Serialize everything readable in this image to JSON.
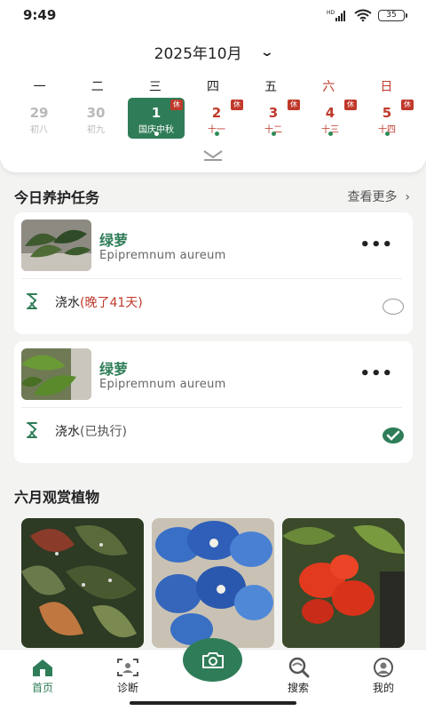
{
  "status": {
    "time": "9:49",
    "network": "HD",
    "battery": "35"
  },
  "calendar": {
    "month": "2025年10月",
    "weekdays": [
      "一",
      "二",
      "三",
      "四",
      "五",
      "六",
      "日"
    ],
    "days": [
      {
        "num": "29",
        "lunar": "初八"
      },
      {
        "num": "30",
        "lunar": "初九"
      },
      {
        "num": "1",
        "lunar": "国庆中秋",
        "badge": "休"
      },
      {
        "num": "2",
        "lunar": "十一",
        "badge": "休"
      },
      {
        "num": "3",
        "lunar": "十二",
        "badge": "休"
      },
      {
        "num": "4",
        "lunar": "十三",
        "badge": "休"
      },
      {
        "num": "5",
        "lunar": "十四",
        "badge": "休"
      }
    ]
  },
  "tasks": {
    "title": "今日养护任务",
    "more": "查看更多",
    "items": [
      {
        "name": "绿萝",
        "latin": "Epipremnum aureum",
        "task": "浇水",
        "status": "(晚了41天)",
        "checked": false
      },
      {
        "name": "绿萝",
        "latin": "Epipremnum aureum",
        "task": "浇水",
        "status": "(已执行)",
        "checked": true
      }
    ]
  },
  "featured": {
    "title": "六月观赏植物"
  },
  "tabs": [
    {
      "label": "首页",
      "icon": "home-icon"
    },
    {
      "label": "诊断",
      "icon": "scan-icon"
    },
    {
      "label": "",
      "icon": "camera-icon"
    },
    {
      "label": "搜索",
      "icon": "search-icon"
    },
    {
      "label": "我的",
      "icon": "profile-icon"
    }
  ],
  "colors": {
    "accent": "#2f7d58",
    "holiday": "#c0392b",
    "background": "#f3f4f2"
  }
}
